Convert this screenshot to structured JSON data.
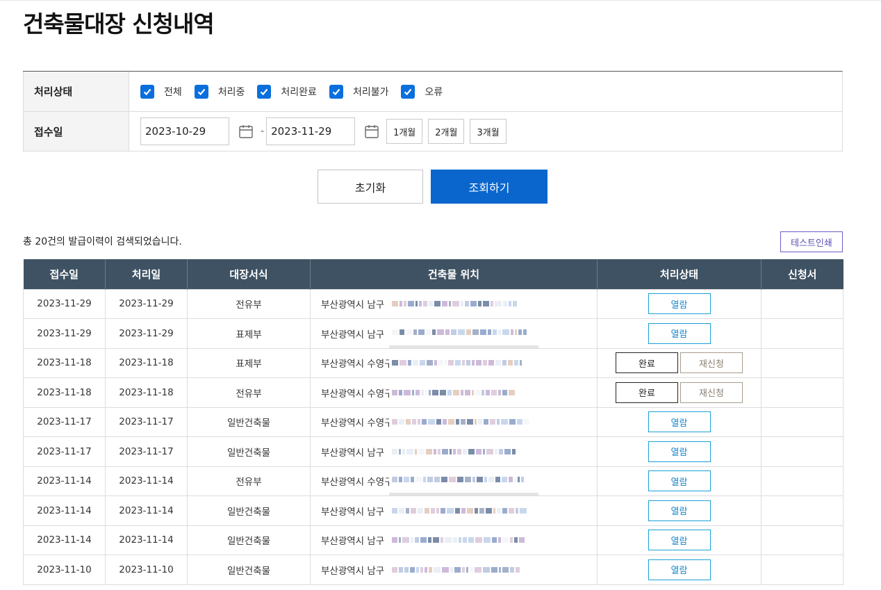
{
  "page": {
    "title": "건축물대장 신청내역"
  },
  "filter": {
    "status_label": "처리상태",
    "statuses": [
      {
        "label": "전체",
        "checked": true
      },
      {
        "label": "처리중",
        "checked": true
      },
      {
        "label": "처리완료",
        "checked": true
      },
      {
        "label": "처리불가",
        "checked": true
      },
      {
        "label": "오류",
        "checked": true
      }
    ],
    "date_label": "접수일",
    "date_from": "2023-10-29",
    "date_to": "2023-11-29",
    "date_separator": "-",
    "period_buttons": [
      "1개월",
      "2개월",
      "3개월"
    ]
  },
  "actions": {
    "reset_label": "초기화",
    "search_label": "조회하기"
  },
  "summary": {
    "text": "총 20건의 발급이력이 검색되었습니다.",
    "test_print_label": "테스트인쇄"
  },
  "table": {
    "headers": [
      "접수일",
      "처리일",
      "대장서식",
      "건축물 위치",
      "처리상태",
      "신청서"
    ],
    "rows": [
      {
        "received": "2023-11-29",
        "processed": "2023-11-29",
        "form": "전유부",
        "location": "부산광역시 남구",
        "status": "view"
      },
      {
        "received": "2023-11-29",
        "processed": "2023-11-29",
        "form": "표제부",
        "location": "부산광역시 남구",
        "status": "view"
      },
      {
        "received": "2023-11-18",
        "processed": "2023-11-18",
        "form": "표제부",
        "location": "부산광역시 수영구",
        "status": "done"
      },
      {
        "received": "2023-11-18",
        "processed": "2023-11-18",
        "form": "전유부",
        "location": "부산광역시 수영구",
        "status": "done"
      },
      {
        "received": "2023-11-17",
        "processed": "2023-11-17",
        "form": "일반건축물",
        "location": "부산광역시 수영구",
        "status": "view"
      },
      {
        "received": "2023-11-17",
        "processed": "2023-11-17",
        "form": "일반건축물",
        "location": "부산광역시 남구",
        "status": "view"
      },
      {
        "received": "2023-11-14",
        "processed": "2023-11-14",
        "form": "전유부",
        "location": "부산광역시 수영구",
        "status": "view"
      },
      {
        "received": "2023-11-14",
        "processed": "2023-11-14",
        "form": "일반건축물",
        "location": "부산광역시 남구",
        "status": "view"
      },
      {
        "received": "2023-11-14",
        "processed": "2023-11-14",
        "form": "일반건축물",
        "location": "부산광역시 남구",
        "status": "view"
      },
      {
        "received": "2023-11-10",
        "processed": "2023-11-10",
        "form": "일반건축물",
        "location": "부산광역시 남구",
        "status": "view"
      }
    ],
    "labels": {
      "view": "열람",
      "done": "완료",
      "reapply": "재신청"
    }
  },
  "colors": {
    "primary": "#0a66cc",
    "header_bg": "#3f5263",
    "view_border": "#1aa0d8",
    "test_print": "#6a5fc9"
  }
}
